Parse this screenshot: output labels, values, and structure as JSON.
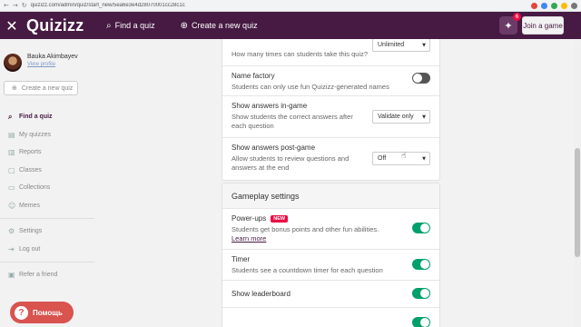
{
  "browser": {
    "back": "←",
    "forward": "→",
    "reload": "↻",
    "url": "quizizz.com/admin/quiz/start_new/5ea6e3e4d28070001cc28c1c"
  },
  "topnav": {
    "close": "✕",
    "logo": "Quizizz",
    "find_quiz": "Find a quiz",
    "create_quiz": "Create a new quiz",
    "gift_badge": "6",
    "join_game": "Join a game"
  },
  "sidebar": {
    "user_name": "Bauka Akimbayev",
    "view_profile": "View profile",
    "create_quiz": "Create a new quiz",
    "items": [
      {
        "label": "Find a quiz",
        "icon": "search-icon",
        "glyph": "⌕",
        "active": true
      },
      {
        "label": "My quizzes",
        "icon": "book-icon",
        "glyph": "▤",
        "active": false
      },
      {
        "label": "Reports",
        "icon": "chart-icon",
        "glyph": "▥",
        "active": false
      },
      {
        "label": "Classes",
        "icon": "classes-icon",
        "glyph": "▢",
        "active": false
      },
      {
        "label": "Collections",
        "icon": "folder-icon",
        "glyph": "▭",
        "active": false
      },
      {
        "label": "Memes",
        "icon": "image-icon",
        "glyph": "☺",
        "active": false
      }
    ],
    "settings": "Settings",
    "logout": "Log out",
    "refer": "Refer a friend",
    "help": "Помощь"
  },
  "settings_card": {
    "attempts_desc": "How many times can students take this quiz?",
    "attempts_value": "Unlimited",
    "name_factory_title": "Name factory",
    "name_factory_desc": "Students can only use fun Quizizz-generated names",
    "show_answers_in_title": "Show answers in-game",
    "show_answers_in_desc": "Show students the correct answers after each question",
    "show_answers_in_value": "Validate only",
    "show_answers_post_title": "Show answers post-game",
    "show_answers_post_desc": "Allow students to review questions and answers at the end",
    "show_answers_post_value": "Off"
  },
  "gameplay": {
    "heading": "Gameplay settings",
    "powerups_title": "Power-ups",
    "new_tag": "NEW",
    "powerups_desc": "Students get bonus points and other fun abilities.",
    "learn_more": "Learn more",
    "timer_title": "Timer",
    "timer_desc": "Students see a countdown timer for each question",
    "leaderboard_title": "Show leaderboard"
  },
  "colors": {
    "brand": "#461a42",
    "toggle_on": "#00a06a",
    "new_badge": "#ec0b43",
    "help": "#d9534f"
  }
}
